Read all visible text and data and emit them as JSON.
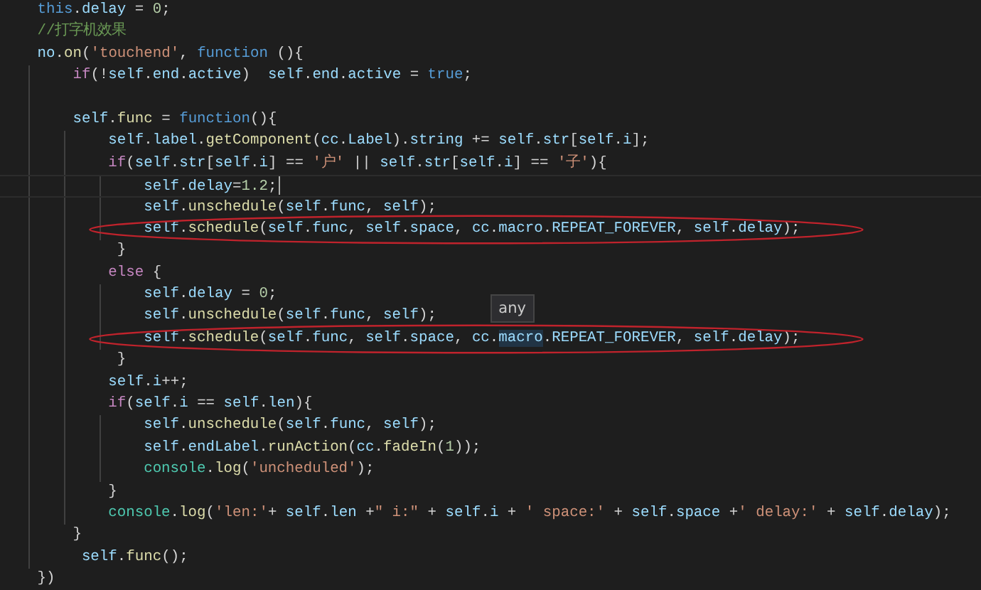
{
  "editor": {
    "lines": [
      {
        "current": false,
        "circled": false,
        "tokens": [
          {
            "t": "this",
            "kind": "keyword"
          },
          {
            "t": ".",
            "kind": "punct"
          },
          {
            "t": "delay",
            "kind": "variable"
          },
          {
            "t": " = ",
            "kind": "punct"
          },
          {
            "t": "0",
            "kind": "number"
          },
          {
            "t": ";",
            "kind": "punct"
          }
        ]
      },
      {
        "current": false,
        "circled": false,
        "tokens": [
          {
            "t": "//打字机效果",
            "kind": "comment"
          }
        ]
      },
      {
        "current": false,
        "circled": false,
        "tokens": [
          {
            "t": "no",
            "kind": "variable"
          },
          {
            "t": ".",
            "kind": "punct"
          },
          {
            "t": "on",
            "kind": "function"
          },
          {
            "t": "(",
            "kind": "punct"
          },
          {
            "t": "'touchend'",
            "kind": "string"
          },
          {
            "t": ", ",
            "kind": "punct"
          },
          {
            "t": "function",
            "kind": "keyword"
          },
          {
            "t": " (){",
            "kind": "punct"
          }
        ]
      },
      {
        "current": false,
        "circled": false,
        "tokens": [
          {
            "t": "    if",
            "kind": "control"
          },
          {
            "t": "(!",
            "kind": "punct"
          },
          {
            "t": "self",
            "kind": "variable"
          },
          {
            "t": ".",
            "kind": "punct"
          },
          {
            "t": "end",
            "kind": "variable"
          },
          {
            "t": ".",
            "kind": "punct"
          },
          {
            "t": "active",
            "kind": "variable"
          },
          {
            "t": ")  ",
            "kind": "punct"
          },
          {
            "t": "self",
            "kind": "variable"
          },
          {
            "t": ".",
            "kind": "punct"
          },
          {
            "t": "end",
            "kind": "variable"
          },
          {
            "t": ".",
            "kind": "punct"
          },
          {
            "t": "active",
            "kind": "variable"
          },
          {
            "t": " = ",
            "kind": "punct"
          },
          {
            "t": "true",
            "kind": "keyword"
          },
          {
            "t": ";",
            "kind": "punct"
          }
        ]
      },
      {
        "current": false,
        "circled": false
      },
      {
        "current": false,
        "circled": false,
        "tokens": [
          {
            "t": "    self",
            "kind": "variable"
          },
          {
            "t": ".",
            "kind": "punct"
          },
          {
            "t": "func",
            "kind": "function"
          },
          {
            "t": " = ",
            "kind": "punct"
          },
          {
            "t": "function",
            "kind": "keyword"
          },
          {
            "t": "(){",
            "kind": "punct"
          }
        ]
      },
      {
        "current": false,
        "circled": false,
        "tokens": [
          {
            "t": "        self",
            "kind": "variable"
          },
          {
            "t": ".",
            "kind": "punct"
          },
          {
            "t": "label",
            "kind": "variable"
          },
          {
            "t": ".",
            "kind": "punct"
          },
          {
            "t": "getComponent",
            "kind": "function"
          },
          {
            "t": "(",
            "kind": "punct"
          },
          {
            "t": "cc",
            "kind": "variable"
          },
          {
            "t": ".",
            "kind": "punct"
          },
          {
            "t": "Label",
            "kind": "variable"
          },
          {
            "t": ").",
            "kind": "punct"
          },
          {
            "t": "string",
            "kind": "variable"
          },
          {
            "t": " += ",
            "kind": "punct"
          },
          {
            "t": "self",
            "kind": "variable"
          },
          {
            "t": ".",
            "kind": "punct"
          },
          {
            "t": "str",
            "kind": "variable"
          },
          {
            "t": "[",
            "kind": "punct"
          },
          {
            "t": "self",
            "kind": "variable"
          },
          {
            "t": ".",
            "kind": "punct"
          },
          {
            "t": "i",
            "kind": "variable"
          },
          {
            "t": "];",
            "kind": "punct"
          }
        ]
      },
      {
        "current": false,
        "circled": false,
        "tokens": [
          {
            "t": "        if",
            "kind": "control"
          },
          {
            "t": "(",
            "kind": "punct"
          },
          {
            "t": "self",
            "kind": "variable"
          },
          {
            "t": ".",
            "kind": "punct"
          },
          {
            "t": "str",
            "kind": "variable"
          },
          {
            "t": "[",
            "kind": "punct"
          },
          {
            "t": "self",
            "kind": "variable"
          },
          {
            "t": ".",
            "kind": "punct"
          },
          {
            "t": "i",
            "kind": "variable"
          },
          {
            "t": "] == ",
            "kind": "punct"
          },
          {
            "t": "'户'",
            "kind": "string"
          },
          {
            "t": " || ",
            "kind": "punct"
          },
          {
            "t": "self",
            "kind": "variable"
          },
          {
            "t": ".",
            "kind": "punct"
          },
          {
            "t": "str",
            "kind": "variable"
          },
          {
            "t": "[",
            "kind": "punct"
          },
          {
            "t": "self",
            "kind": "variable"
          },
          {
            "t": ".",
            "kind": "punct"
          },
          {
            "t": "i",
            "kind": "variable"
          },
          {
            "t": "] == ",
            "kind": "punct"
          },
          {
            "t": "'子'",
            "kind": "string"
          },
          {
            "t": "){",
            "kind": "punct"
          }
        ]
      },
      {
        "current": true,
        "circled": false,
        "tokens": [
          {
            "t": "            self",
            "kind": "variable"
          },
          {
            "t": ".",
            "kind": "punct"
          },
          {
            "t": "delay",
            "kind": "variable"
          },
          {
            "t": "=",
            "kind": "punct"
          },
          {
            "t": "1.2",
            "kind": "number"
          },
          {
            "t": ";",
            "kind": "punct"
          }
        ]
      },
      {
        "current": false,
        "circled": false,
        "tokens": [
          {
            "t": "            self",
            "kind": "variable"
          },
          {
            "t": ".",
            "kind": "punct"
          },
          {
            "t": "unschedule",
            "kind": "function"
          },
          {
            "t": "(",
            "kind": "punct"
          },
          {
            "t": "self",
            "kind": "variable"
          },
          {
            "t": ".",
            "kind": "punct"
          },
          {
            "t": "func",
            "kind": "variable"
          },
          {
            "t": ", ",
            "kind": "punct"
          },
          {
            "t": "self",
            "kind": "variable"
          },
          {
            "t": ");",
            "kind": "punct"
          }
        ]
      },
      {
        "current": false,
        "circled": true,
        "tokens": [
          {
            "t": "            self",
            "kind": "variable"
          },
          {
            "t": ".",
            "kind": "punct"
          },
          {
            "t": "schedule",
            "kind": "function"
          },
          {
            "t": "(",
            "kind": "punct"
          },
          {
            "t": "self",
            "kind": "variable"
          },
          {
            "t": ".",
            "kind": "punct"
          },
          {
            "t": "func",
            "kind": "variable"
          },
          {
            "t": ", ",
            "kind": "punct"
          },
          {
            "t": "self",
            "kind": "variable"
          },
          {
            "t": ".",
            "kind": "punct"
          },
          {
            "t": "space",
            "kind": "variable"
          },
          {
            "t": ", ",
            "kind": "punct"
          },
          {
            "t": "cc",
            "kind": "variable"
          },
          {
            "t": ".",
            "kind": "punct"
          },
          {
            "t": "macro",
            "kind": "variable"
          },
          {
            "t": ".",
            "kind": "punct"
          },
          {
            "t": "REPEAT_FOREVER",
            "kind": "variable"
          },
          {
            "t": ", ",
            "kind": "punct"
          },
          {
            "t": "self",
            "kind": "variable"
          },
          {
            "t": ".",
            "kind": "punct"
          },
          {
            "t": "delay",
            "kind": "variable"
          },
          {
            "t": ");",
            "kind": "punct"
          }
        ]
      },
      {
        "current": false,
        "circled": false,
        "tokens": [
          {
            "t": "         }",
            "kind": "punct"
          }
        ]
      },
      {
        "current": false,
        "circled": false,
        "tokens": [
          {
            "t": "        else",
            "kind": "control"
          },
          {
            "t": " {",
            "kind": "punct"
          }
        ]
      },
      {
        "current": false,
        "circled": false,
        "tokens": [
          {
            "t": "            self",
            "kind": "variable"
          },
          {
            "t": ".",
            "kind": "punct"
          },
          {
            "t": "delay",
            "kind": "variable"
          },
          {
            "t": " = ",
            "kind": "punct"
          },
          {
            "t": "0",
            "kind": "number"
          },
          {
            "t": ";",
            "kind": "punct"
          }
        ]
      },
      {
        "current": false,
        "circled": false,
        "tokens": [
          {
            "t": "            self",
            "kind": "variable"
          },
          {
            "t": ".",
            "kind": "punct"
          },
          {
            "t": "unschedule",
            "kind": "function"
          },
          {
            "t": "(",
            "kind": "punct"
          },
          {
            "t": "self",
            "kind": "variable"
          },
          {
            "t": ".",
            "kind": "punct"
          },
          {
            "t": "func",
            "kind": "variable"
          },
          {
            "t": ", ",
            "kind": "punct"
          },
          {
            "t": "self",
            "kind": "variable"
          },
          {
            "t": ");",
            "kind": "punct"
          }
        ]
      },
      {
        "current": false,
        "circled": true,
        "tokens": [
          {
            "t": "            self",
            "kind": "variable"
          },
          {
            "t": ".",
            "kind": "punct"
          },
          {
            "t": "schedule",
            "kind": "function"
          },
          {
            "t": "(",
            "kind": "punct"
          },
          {
            "t": "self",
            "kind": "variable"
          },
          {
            "t": ".",
            "kind": "punct"
          },
          {
            "t": "func",
            "kind": "variable"
          },
          {
            "t": ", ",
            "kind": "punct"
          },
          {
            "t": "self",
            "kind": "variable"
          },
          {
            "t": ".",
            "kind": "punct"
          },
          {
            "t": "space",
            "kind": "variable"
          },
          {
            "t": ", ",
            "kind": "punct"
          },
          {
            "t": "cc",
            "kind": "variable"
          },
          {
            "t": ".",
            "kind": "punct"
          },
          {
            "t": "macro",
            "kind": "variable",
            "hover": "any"
          },
          {
            "t": ".",
            "kind": "punct"
          },
          {
            "t": "REPEAT_FOREVER",
            "kind": "variable"
          },
          {
            "t": ", ",
            "kind": "punct"
          },
          {
            "t": "self",
            "kind": "variable"
          },
          {
            "t": ".",
            "kind": "punct"
          },
          {
            "t": "delay",
            "kind": "variable"
          },
          {
            "t": ");",
            "kind": "punct"
          }
        ]
      },
      {
        "current": false,
        "circled": false,
        "tokens": [
          {
            "t": "         }",
            "kind": "punct"
          }
        ]
      },
      {
        "current": false,
        "circled": false,
        "tokens": [
          {
            "t": "        self",
            "kind": "variable"
          },
          {
            "t": ".",
            "kind": "punct"
          },
          {
            "t": "i",
            "kind": "variable"
          },
          {
            "t": "++;",
            "kind": "punct"
          }
        ]
      },
      {
        "current": false,
        "circled": false,
        "tokens": [
          {
            "t": "        if",
            "kind": "control"
          },
          {
            "t": "(",
            "kind": "punct"
          },
          {
            "t": "self",
            "kind": "variable"
          },
          {
            "t": ".",
            "kind": "punct"
          },
          {
            "t": "i",
            "kind": "variable"
          },
          {
            "t": " == ",
            "kind": "punct"
          },
          {
            "t": "self",
            "kind": "variable"
          },
          {
            "t": ".",
            "kind": "punct"
          },
          {
            "t": "len",
            "kind": "variable"
          },
          {
            "t": "){",
            "kind": "punct"
          }
        ]
      },
      {
        "current": false,
        "circled": false,
        "tokens": [
          {
            "t": "            self",
            "kind": "variable"
          },
          {
            "t": ".",
            "kind": "punct"
          },
          {
            "t": "unschedule",
            "kind": "function"
          },
          {
            "t": "(",
            "kind": "punct"
          },
          {
            "t": "self",
            "kind": "variable"
          },
          {
            "t": ".",
            "kind": "punct"
          },
          {
            "t": "func",
            "kind": "variable"
          },
          {
            "t": ", ",
            "kind": "punct"
          },
          {
            "t": "self",
            "kind": "variable"
          },
          {
            "t": ");",
            "kind": "punct"
          }
        ]
      },
      {
        "current": false,
        "circled": false,
        "tokens": [
          {
            "t": "            self",
            "kind": "variable"
          },
          {
            "t": ".",
            "kind": "punct"
          },
          {
            "t": "endLabel",
            "kind": "variable"
          },
          {
            "t": ".",
            "kind": "punct"
          },
          {
            "t": "runAction",
            "kind": "function"
          },
          {
            "t": "(",
            "kind": "punct"
          },
          {
            "t": "cc",
            "kind": "variable"
          },
          {
            "t": ".",
            "kind": "punct"
          },
          {
            "t": "fadeIn",
            "kind": "function"
          },
          {
            "t": "(",
            "kind": "punct"
          },
          {
            "t": "1",
            "kind": "number"
          },
          {
            "t": "));",
            "kind": "punct"
          }
        ]
      },
      {
        "current": false,
        "circled": false,
        "tokens": [
          {
            "t": "            console",
            "kind": "type"
          },
          {
            "t": ".",
            "kind": "punct"
          },
          {
            "t": "log",
            "kind": "function"
          },
          {
            "t": "(",
            "kind": "punct"
          },
          {
            "t": "'uncheduled'",
            "kind": "string"
          },
          {
            "t": ");",
            "kind": "punct"
          }
        ]
      },
      {
        "current": false,
        "circled": false,
        "tokens": [
          {
            "t": "        }",
            "kind": "punct"
          }
        ]
      },
      {
        "current": false,
        "circled": false,
        "tokens": [
          {
            "t": "        console",
            "kind": "type"
          },
          {
            "t": ".",
            "kind": "punct"
          },
          {
            "t": "log",
            "kind": "function"
          },
          {
            "t": "(",
            "kind": "punct"
          },
          {
            "t": "'len:'",
            "kind": "string"
          },
          {
            "t": "+ ",
            "kind": "punct"
          },
          {
            "t": "self",
            "kind": "variable"
          },
          {
            "t": ".",
            "kind": "punct"
          },
          {
            "t": "len",
            "kind": "variable"
          },
          {
            "t": " +",
            "kind": "punct"
          },
          {
            "t": "\" i:\"",
            "kind": "string"
          },
          {
            "t": " + ",
            "kind": "punct"
          },
          {
            "t": "self",
            "kind": "variable"
          },
          {
            "t": ".",
            "kind": "punct"
          },
          {
            "t": "i",
            "kind": "variable"
          },
          {
            "t": " + ",
            "kind": "punct"
          },
          {
            "t": "' space:'",
            "kind": "string"
          },
          {
            "t": " + ",
            "kind": "punct"
          },
          {
            "t": "self",
            "kind": "variable"
          },
          {
            "t": ".",
            "kind": "punct"
          },
          {
            "t": "space",
            "kind": "variable"
          },
          {
            "t": " +",
            "kind": "punct"
          },
          {
            "t": "' delay:'",
            "kind": "string"
          },
          {
            "t": " + ",
            "kind": "punct"
          },
          {
            "t": "self",
            "kind": "variable"
          },
          {
            "t": ".",
            "kind": "punct"
          },
          {
            "t": "delay",
            "kind": "variable"
          },
          {
            "t": ");",
            "kind": "punct"
          }
        ]
      },
      {
        "current": false,
        "circled": false,
        "tokens": [
          {
            "t": "    }",
            "kind": "punct"
          }
        ]
      },
      {
        "current": false,
        "circled": false,
        "tokens": [
          {
            "t": "     self",
            "kind": "variable"
          },
          {
            "t": ".",
            "kind": "punct"
          },
          {
            "t": "func",
            "kind": "function"
          },
          {
            "t": "();",
            "kind": "punct"
          }
        ]
      },
      {
        "current": false,
        "circled": false,
        "tokens": [
          {
            "t": "})",
            "kind": "punct"
          }
        ]
      }
    ]
  }
}
